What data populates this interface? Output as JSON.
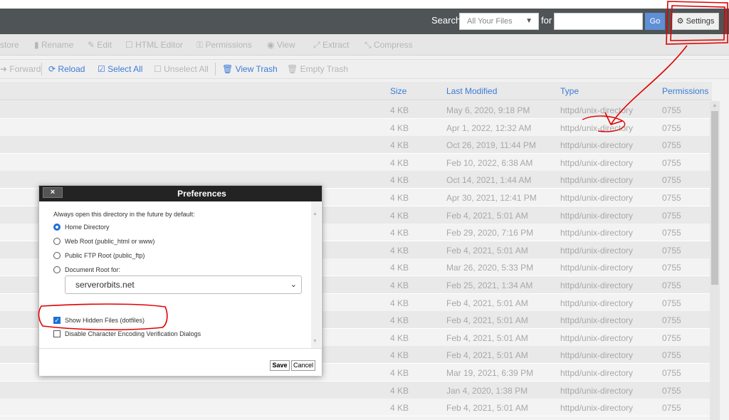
{
  "header": {
    "search_label": "Search",
    "search_scope": "All Your Files",
    "for_label": "for",
    "search_value": "",
    "go_label": "Go",
    "settings_label": "Settings"
  },
  "toolbar1": {
    "items": [
      "store",
      "Rename",
      "Edit",
      "HTML Editor",
      "Permissions",
      "View",
      "Extract",
      "Compress"
    ]
  },
  "toolbar2": {
    "forward": "Forward",
    "reload": "Reload",
    "select_all": "Select All",
    "unselect_all": "Unselect All",
    "view_trash": "View Trash",
    "empty_trash": "Empty Trash"
  },
  "table": {
    "columns": [
      "Size",
      "Last Modified",
      "Type",
      "Permissions"
    ],
    "rows": [
      {
        "size": "4 KB",
        "modified": "May 6, 2020, 9:18 PM",
        "type": "httpd/unix-directory",
        "perm": "0755"
      },
      {
        "size": "4 KB",
        "modified": "Apr 1, 2022, 12:32 AM",
        "type": "httpd/unix-directory",
        "perm": "0755"
      },
      {
        "size": "4 KB",
        "modified": "Oct 26, 2019, 11:44 PM",
        "type": "httpd/unix-directory",
        "perm": "0755"
      },
      {
        "size": "4 KB",
        "modified": "Feb 10, 2022, 6:38 AM",
        "type": "httpd/unix-directory",
        "perm": "0755"
      },
      {
        "size": "4 KB",
        "modified": "Oct 14, 2021, 1:44 AM",
        "type": "httpd/unix-directory",
        "perm": "0755"
      },
      {
        "size": "4 KB",
        "modified": "Apr 30, 2021, 12:41 PM",
        "type": "httpd/unix-directory",
        "perm": "0755"
      },
      {
        "size": "4 KB",
        "modified": "Feb 4, 2021, 5:01 AM",
        "type": "httpd/unix-directory",
        "perm": "0755"
      },
      {
        "size": "4 KB",
        "modified": "Feb 29, 2020, 7:16 PM",
        "type": "httpd/unix-directory",
        "perm": "0755"
      },
      {
        "size": "4 KB",
        "modified": "Feb 4, 2021, 5:01 AM",
        "type": "httpd/unix-directory",
        "perm": "0755"
      },
      {
        "size": "4 KB",
        "modified": "Mar 26, 2020, 5:33 PM",
        "type": "httpd/unix-directory",
        "perm": "0755"
      },
      {
        "size": "4 KB",
        "modified": "Feb 25, 2021, 1:34 AM",
        "type": "httpd/unix-directory",
        "perm": "0755"
      },
      {
        "size": "4 KB",
        "modified": "Feb 4, 2021, 5:01 AM",
        "type": "httpd/unix-directory",
        "perm": "0755"
      },
      {
        "size": "4 KB",
        "modified": "Feb 4, 2021, 5:01 AM",
        "type": "httpd/unix-directory",
        "perm": "0755"
      },
      {
        "size": "4 KB",
        "modified": "Feb 4, 2021, 5:01 AM",
        "type": "httpd/unix-directory",
        "perm": "0755"
      },
      {
        "size": "4 KB",
        "modified": "Feb 4, 2021, 5:01 AM",
        "type": "httpd/unix-directory",
        "perm": "0755"
      },
      {
        "size": "4 KB",
        "modified": "Mar 19, 2021, 6:39 PM",
        "type": "httpd/unix-directory",
        "perm": "0755"
      },
      {
        "size": "4 KB",
        "modified": "Jan 4, 2020, 1:38 PM",
        "type": "httpd/unix-directory",
        "perm": "0755"
      },
      {
        "size": "4 KB",
        "modified": "Feb 4, 2021, 5:01 AM",
        "type": "httpd/unix-directory",
        "perm": "0755"
      }
    ]
  },
  "dialog": {
    "title": "Preferences",
    "close": "×",
    "intro": "Always open this directory in the future by default:",
    "options": [
      "Home Directory",
      "Web Root (public_html or www)",
      "Public FTP Root (public_ftp)",
      "Document Root for:"
    ],
    "selected_option": "Home Directory",
    "doc_root_value": "serverorbits.net",
    "show_hidden": "Show Hidden Files (dotfiles)",
    "show_hidden_checked": true,
    "disable_encoding": "Disable Character Encoding Verification Dialogs",
    "disable_encoding_checked": false,
    "save": "Save",
    "cancel": "Cancel"
  },
  "colors": {
    "accent": "#3d7bd6",
    "navbar": "#4f5457",
    "annotation": "#e00000"
  }
}
